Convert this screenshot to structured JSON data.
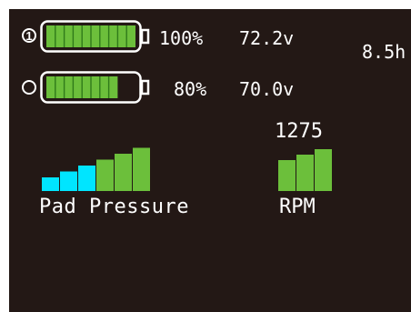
{
  "colors": {
    "background": "#231815",
    "text": "#ffffff",
    "battery_fill": "#6cbf3b",
    "pressure_low": "#00e5ff",
    "pressure_high": "#6cbf3b"
  },
  "batteries": [
    {
      "selector": "1",
      "selected": true,
      "percent_text": "100%",
      "voltage_text": "72.2v",
      "level": 1.0,
      "cells": 10
    },
    {
      "selector": "",
      "selected": false,
      "percent_text": "80%",
      "voltage_text": "70.0v",
      "level": 0.8,
      "cells": 10
    }
  ],
  "runtime_text": "8.5h",
  "pad_pressure": {
    "label": "Pad Pressure",
    "bars_total": 6,
    "bars_cyan": 3,
    "bars_green": 3
  },
  "rpm": {
    "label": "RPM",
    "value_text": "1275",
    "bars_total": 3,
    "bars_lit": 3
  }
}
